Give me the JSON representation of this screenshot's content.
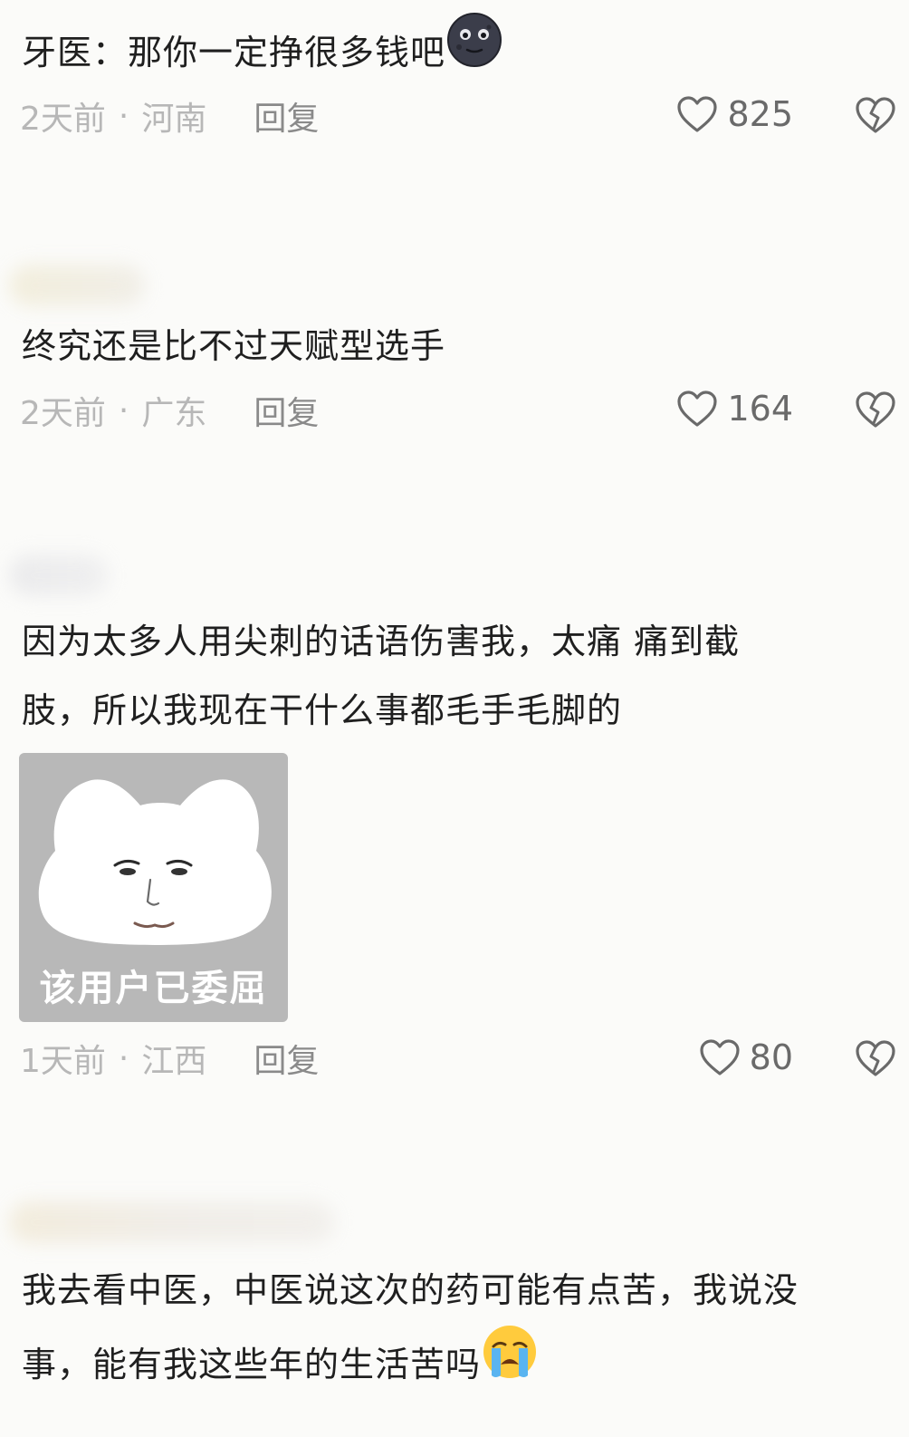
{
  "comments": [
    {
      "text": "牙医：那你一定挣很多钱吧",
      "emoji": "dark-moon-face-emoji",
      "time": "2天前",
      "dot": "·",
      "location": "河南",
      "reply": "回复",
      "likes": "825"
    },
    {
      "text": "终究还是比不过天赋型选手",
      "time": "2天前",
      "dot": "·",
      "location": "广东",
      "reply": "回复",
      "likes": "164"
    },
    {
      "text_line1": "因为太多人用尖刺的话语伤害我，太痛 痛到截",
      "text_line2": "肢，所以我现在干什么事都毛手毛脚的",
      "sticker_caption": "该用户已委屈",
      "time": "1天前",
      "dot": "·",
      "location": "江西",
      "reply": "回复",
      "likes": "80"
    },
    {
      "text_line1": "我去看中医，中医说这次的药可能有点苦，我说没",
      "text_line2": "事，能有我这些年的生活苦吗",
      "emoji": "loudly-crying-face-emoji"
    }
  ],
  "icons": {
    "like": "heart-outline-icon",
    "dislike": "broken-heart-icon"
  },
  "colors": {
    "background": "#fbfbf9",
    "meta_text": "#b7b7b7",
    "reply_text": "#8a8a8a",
    "main_text": "#1f1f1f"
  }
}
